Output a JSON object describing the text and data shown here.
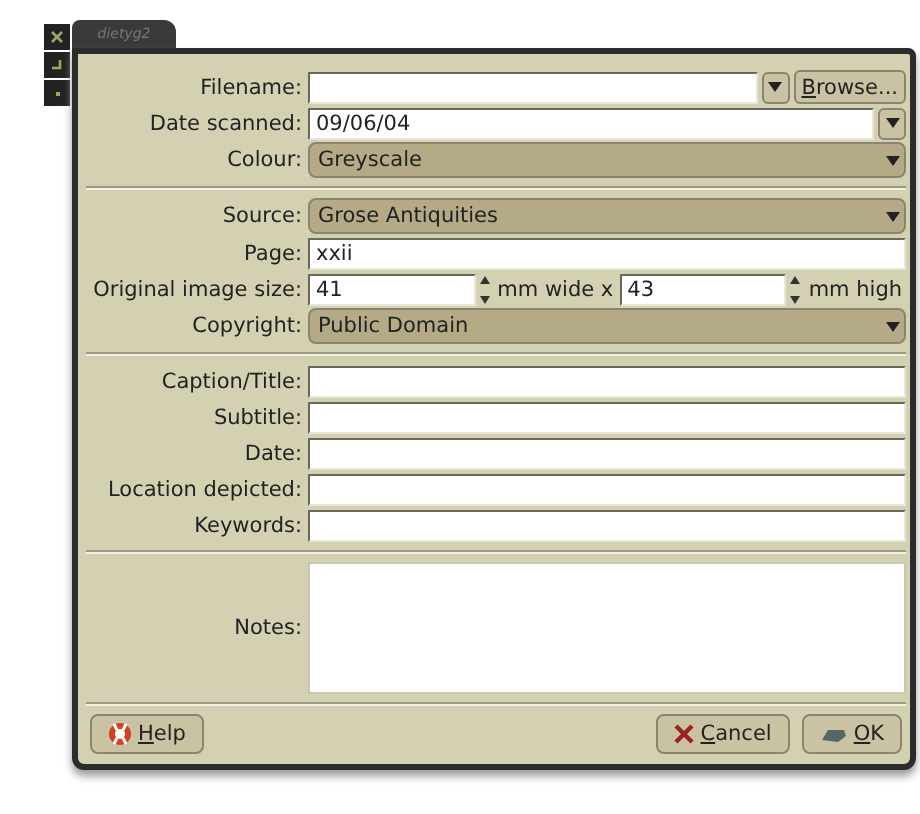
{
  "window": {
    "title": "dietyg2"
  },
  "sections": [
    {
      "rows": [
        {
          "kind": "combo-entry",
          "label": "Filename:",
          "value": "",
          "button": {
            "label": "Browse...",
            "access_key": true
          }
        },
        {
          "kind": "entry-combo",
          "label": "Date scanned:",
          "value": "09/06/04"
        },
        {
          "kind": "combo",
          "label": "Colour:",
          "value": "Greyscale"
        }
      ]
    },
    {
      "rows": [
        {
          "kind": "combo",
          "label": "Source:",
          "value": "Grose Antiquities"
        },
        {
          "kind": "entry",
          "label": "Page:",
          "value": "xxii"
        },
        {
          "kind": "spin-pair",
          "label": "Original image size:",
          "value": "41",
          "middle": "mm wide x",
          "value2": "43",
          "unit": "mm high"
        },
        {
          "kind": "combo",
          "label": "Copyright:",
          "value": "Public Domain"
        }
      ]
    },
    {
      "rows": [
        {
          "kind": "entry",
          "label": "Caption/Title:",
          "value": ""
        },
        {
          "kind": "entry",
          "label": "Subtitle:",
          "value": ""
        },
        {
          "kind": "entry",
          "label": "Date:",
          "value": ""
        },
        {
          "kind": "entry",
          "label": "Location depicted:",
          "value": ""
        },
        {
          "kind": "entry",
          "label": "Keywords:",
          "value": ""
        }
      ]
    },
    {
      "rows": [
        {
          "kind": "textarea",
          "label": "Notes:",
          "value": ""
        }
      ]
    }
  ],
  "buttons": [
    {
      "kind": "help",
      "label": "Help",
      "access_key": true
    },
    {
      "kind": "cancel",
      "label": "Cancel",
      "access_key": true
    },
    {
      "kind": "ok",
      "label": "OK",
      "access_key": true
    }
  ]
}
